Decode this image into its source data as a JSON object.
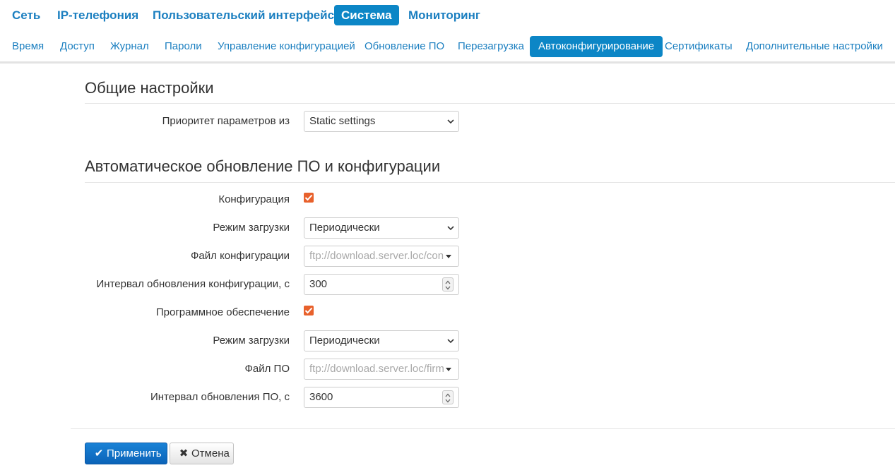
{
  "topnav": {
    "items": [
      {
        "label": "Сеть",
        "active": false
      },
      {
        "label": "IP-телефония",
        "active": false
      },
      {
        "label": "Пользовательский интерфейс",
        "active": false
      },
      {
        "label": "Система",
        "active": true
      },
      {
        "label": "Мониторинг",
        "active": false
      }
    ]
  },
  "subnav": {
    "items": [
      {
        "label": "Время",
        "active": false
      },
      {
        "label": "Доступ",
        "active": false
      },
      {
        "label": "Журнал",
        "active": false
      },
      {
        "label": "Пароли",
        "active": false
      },
      {
        "label": "Управление конфигурацией",
        "active": false
      },
      {
        "label": "Обновление ПО",
        "active": false
      },
      {
        "label": "Перезагрузка",
        "active": false
      },
      {
        "label": "Автоконфигурирование",
        "active": true
      },
      {
        "label": "Сертификаты",
        "active": false
      },
      {
        "label": "Дополнительные настройки",
        "active": false
      }
    ]
  },
  "general": {
    "title": "Общие настройки",
    "priority_label": "Приоритет параметров из",
    "priority_value": "Static settings"
  },
  "auto_update": {
    "title": "Автоматическое обновление ПО и конфигурации",
    "config_label": "Конфигурация",
    "config_checked": true,
    "config_mode_label": "Режим загрузки",
    "config_mode_value": "Периодически",
    "config_file_label": "Файл конфигурации",
    "config_file_placeholder": "ftp://download.server.loc/config",
    "config_interval_label": "Интервал обновления конфигурации, с",
    "config_interval_value": "300",
    "firmware_label": "Программное обеспечение",
    "firmware_checked": true,
    "firmware_mode_label": "Режим загрузки",
    "firmware_mode_value": "Периодически",
    "firmware_file_label": "Файл ПО",
    "firmware_file_placeholder": "ftp://download.server.loc/firmware",
    "firmware_interval_label": "Интервал обновления ПО, с",
    "firmware_interval_value": "3600"
  },
  "actions": {
    "apply_label": "Применить",
    "cancel_label": "Отмена"
  },
  "colors": {
    "accent": "#0c86c6",
    "link": "#1b7fc0",
    "checkbox": "#e8612c",
    "primary_button": "#0b63b8"
  }
}
